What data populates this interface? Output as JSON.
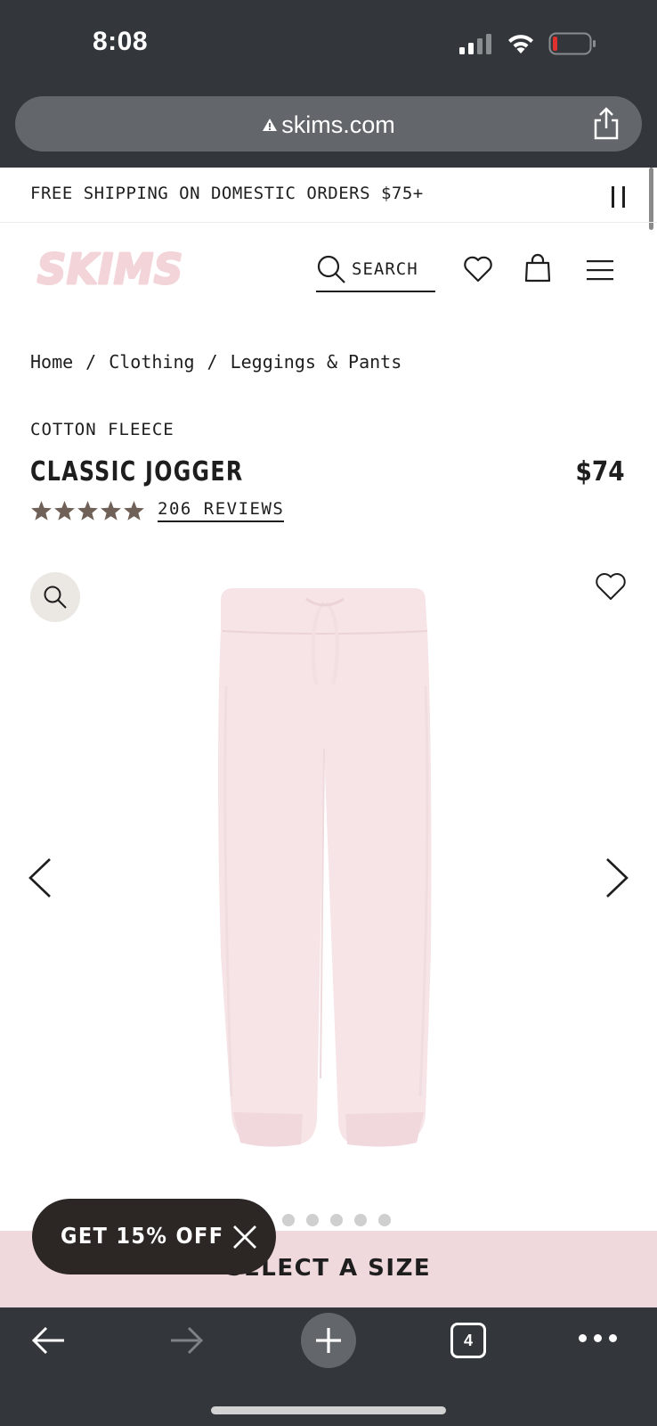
{
  "status_bar": {
    "time": "8:08",
    "battery_color": "#e0312f"
  },
  "browser": {
    "url": "skims.com",
    "open_tabs": "4"
  },
  "promo_banner": {
    "text": "FREE SHIPPING ON DOMESTIC ORDERS $75+"
  },
  "header": {
    "logo_text": "SKIMS",
    "logo_color": "#f2d4d9",
    "search_label": "SEARCH"
  },
  "breadcrumb": {
    "items": [
      "Home",
      "Clothing",
      "Leggings & Pants"
    ],
    "separator": "/"
  },
  "product": {
    "collection": "COTTON FLEECE",
    "title": "CLASSIC JOGGER",
    "price": "$74",
    "rating_stars": 5,
    "reviews_label": "206 REVIEWS",
    "image_color": "#f6e4e6"
  },
  "gallery": {
    "image_count": 6,
    "active_index": 0
  },
  "size_bar": {
    "label": "SELECT A SIZE",
    "background": "#efd9dd"
  },
  "discount": {
    "label": "GET 15% OFF"
  }
}
